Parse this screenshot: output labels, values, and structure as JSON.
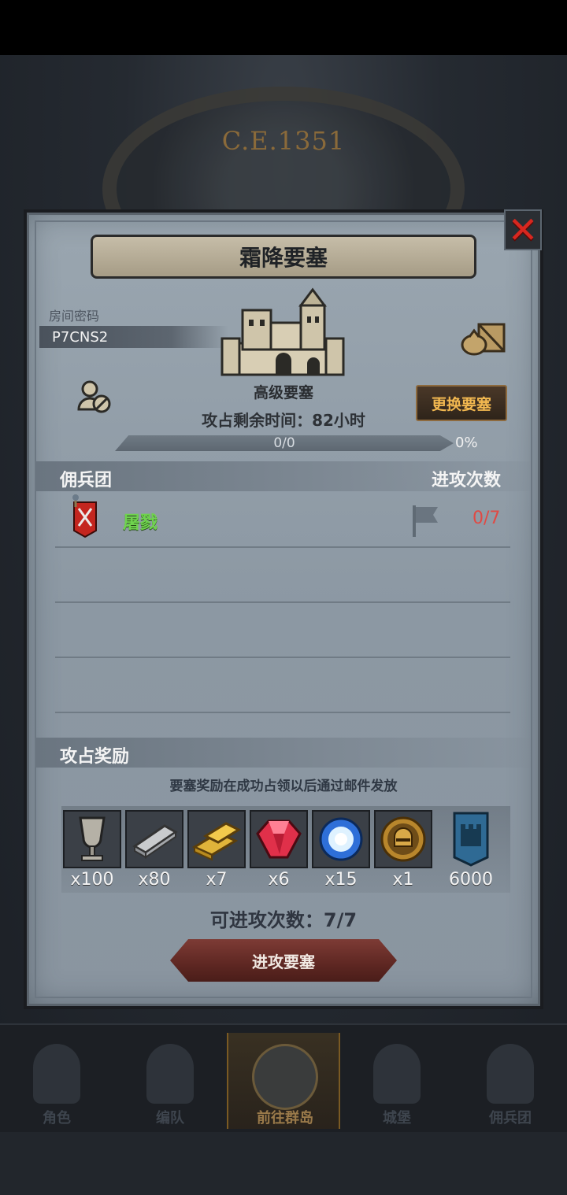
{
  "background": {
    "year": "C.E.1351"
  },
  "dialog": {
    "title": "霜降要塞",
    "close_icon": "close-x-icon",
    "room_label": "房间密码",
    "room_code": "P7CNS2",
    "fortress_level": "高级要塞",
    "switch_button": "更换要塞",
    "time_remaining": "攻占剩余时间：82小时",
    "progress": {
      "count": "0/0",
      "percent": "0%",
      "fraction": 0
    }
  },
  "mercenary": {
    "header": "佣兵团",
    "attack_header": "进攻次数",
    "rows": [
      {
        "name": "屠戮",
        "attacks": "0/7"
      }
    ]
  },
  "rewards": {
    "header": "攻占奖励",
    "notice": "要塞奖励在成功占领以后通过邮件发放",
    "items": [
      {
        "icon": "goblet-icon",
        "qty": "x100"
      },
      {
        "icon": "iron-ingot-icon",
        "qty": "x80"
      },
      {
        "icon": "gold-bars-icon",
        "qty": "x7"
      },
      {
        "icon": "ruby-icon",
        "qty": "x6"
      },
      {
        "icon": "crystal-orb-icon",
        "qty": "x15"
      },
      {
        "icon": "knight-medal-icon",
        "qty": "x1"
      },
      {
        "icon": "fortress-banner-icon",
        "qty": "6000"
      }
    ]
  },
  "attacks_available": "可进攻次数：7/7",
  "attack_button": "进攻要塞",
  "nav": [
    {
      "label": "角色",
      "active": false
    },
    {
      "label": "编队",
      "active": false
    },
    {
      "label": "前往群岛",
      "active": true
    },
    {
      "label": "城堡",
      "active": false
    },
    {
      "label": "佣兵团",
      "active": false
    }
  ]
}
